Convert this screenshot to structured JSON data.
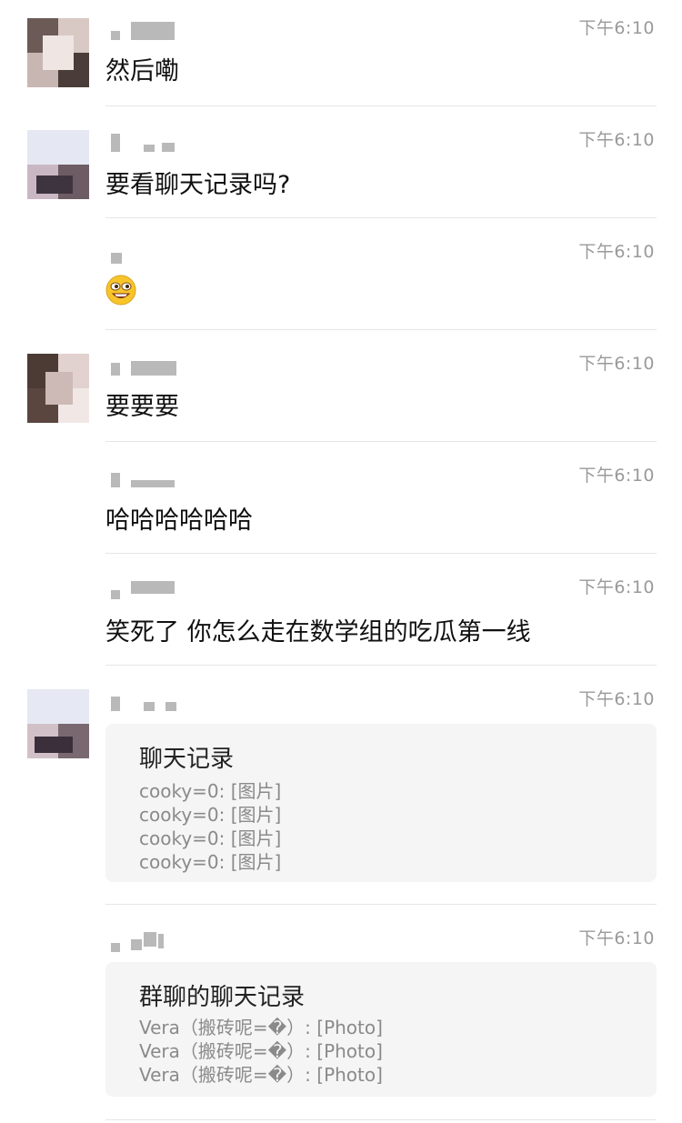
{
  "messages": [
    {
      "time": "下午6:10",
      "text": "然后嘞"
    },
    {
      "time": "下午6:10",
      "text": "要看聊天记录吗?"
    },
    {
      "time": "下午6:10",
      "emoji": "grinning-face-emoji"
    },
    {
      "time": "下午6:10",
      "text": "要要要"
    },
    {
      "time": "下午6:10",
      "text": "哈哈哈哈哈哈"
    },
    {
      "time": "下午6:10",
      "text": "笑死了 你怎么走在数学组的吃瓜第一线"
    },
    {
      "time": "下午6:10",
      "card": {
        "title": "聊天记录",
        "lines": [
          "cooky=0: [图片]",
          "cooky=0: [图片]",
          "cooky=0: [图片]",
          "cooky=0: [图片]"
        ]
      }
    },
    {
      "time": "下午6:10",
      "card": {
        "title": "群聊的聊天记录",
        "lines": [
          "Vera（搬砖呢=�）: [Photo]",
          "Vera（搬砖呢=�）: [Photo]",
          "Vera（搬砖呢=�）: [Photo]"
        ]
      }
    }
  ],
  "colors": {
    "divider": "#e6e6e6",
    "card_bg": "#f5f5f5",
    "time": "#9a9a9a"
  }
}
